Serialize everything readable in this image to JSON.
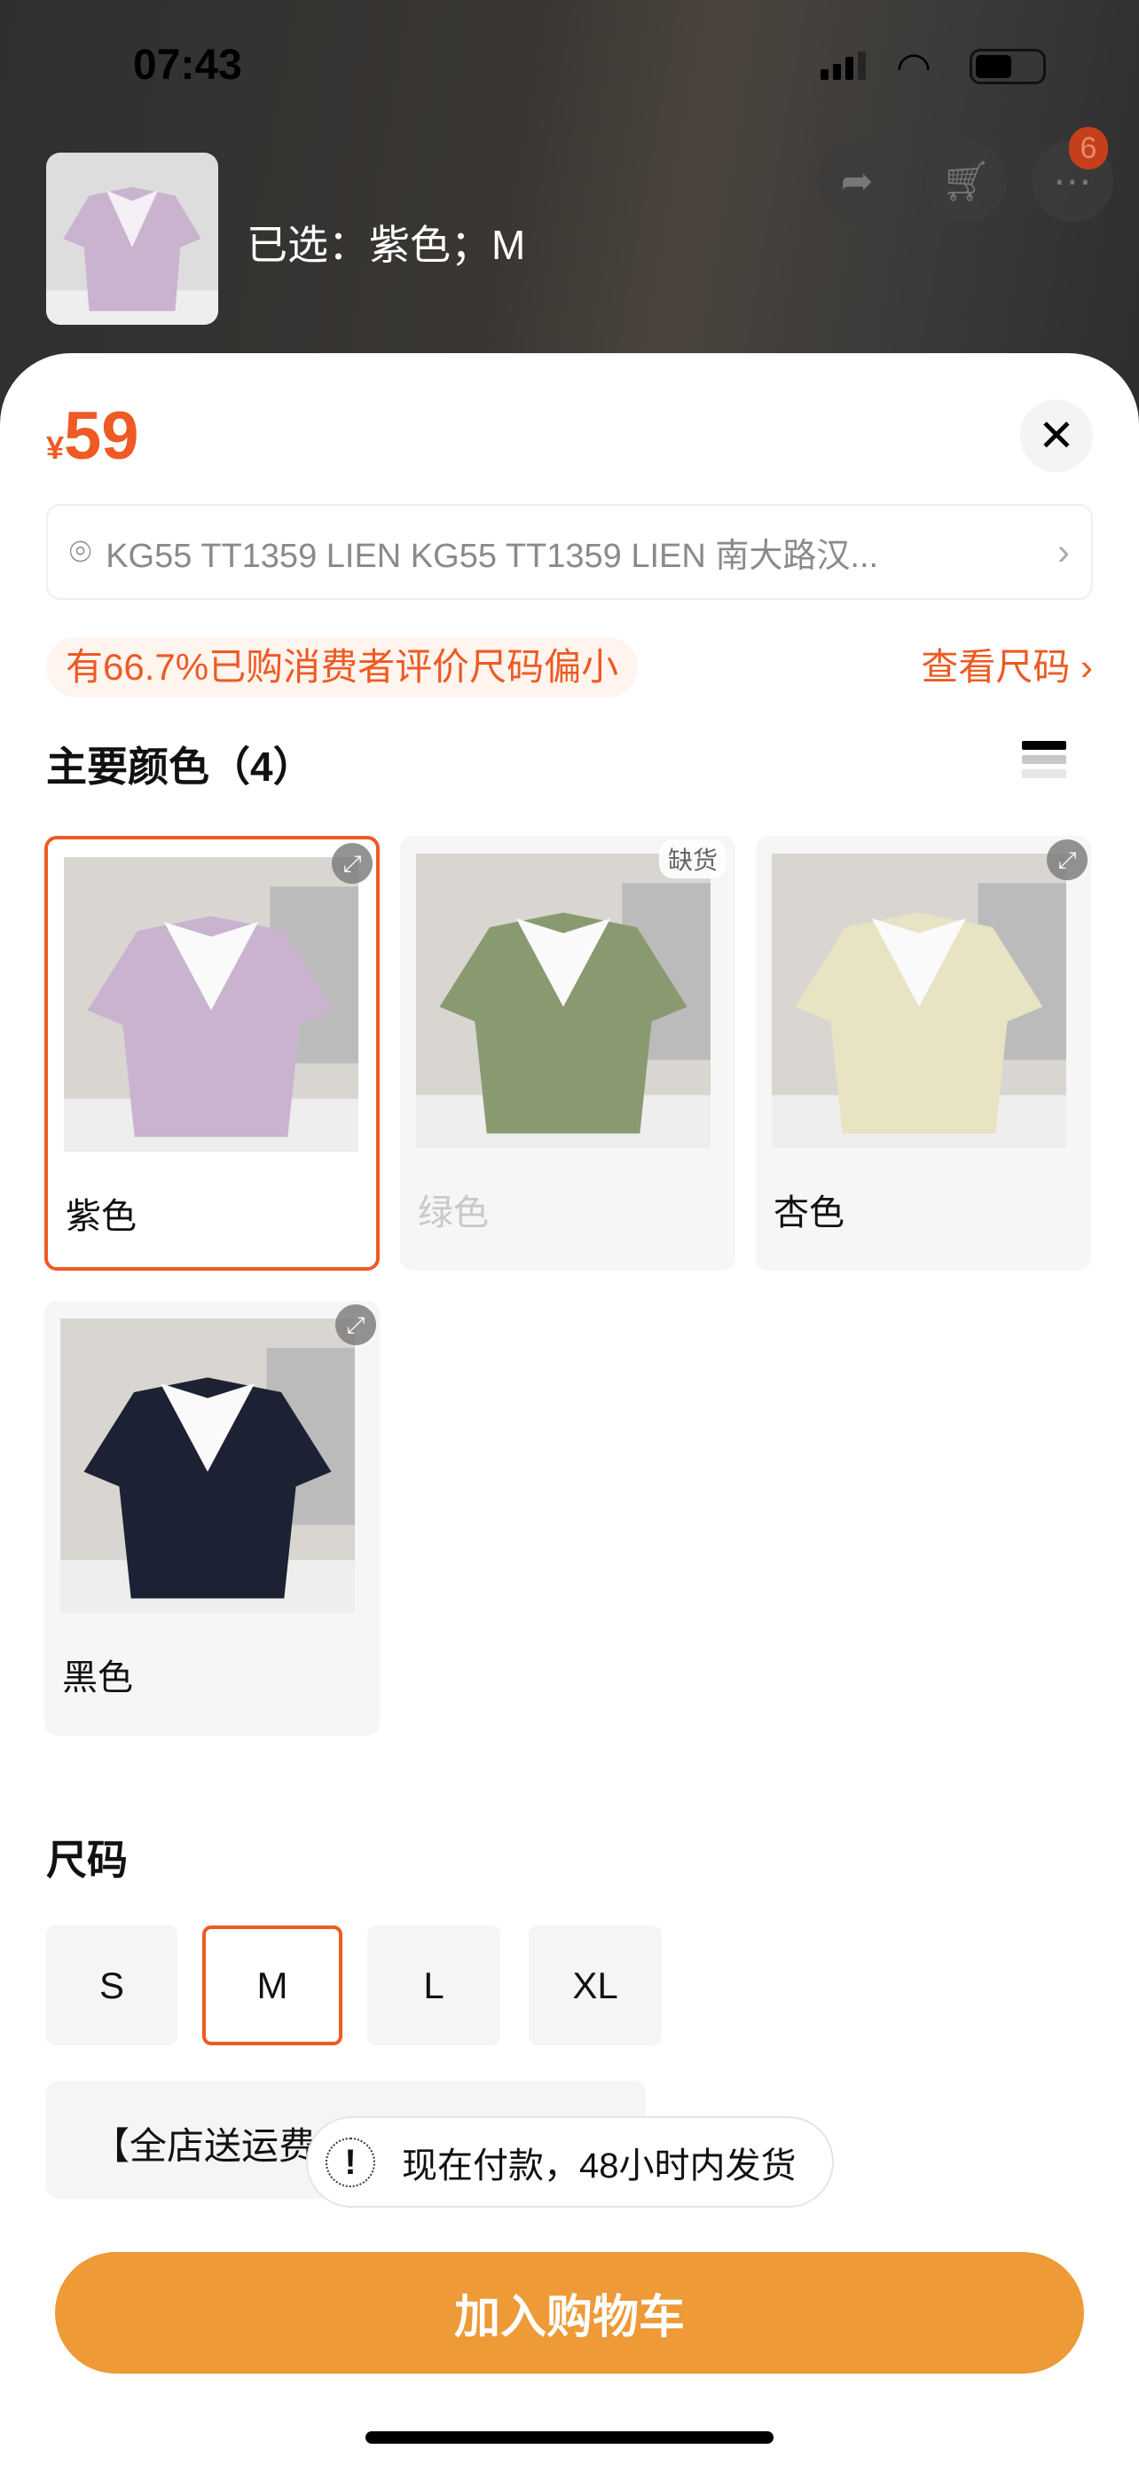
{
  "status_bar": {
    "time": "07:43"
  },
  "header": {
    "selected_text": "已选：紫色；M",
    "cart_badge": "6"
  },
  "price": {
    "currency": "¥",
    "value": "59"
  },
  "address": {
    "text": "KG55 TT1359 LIEN KG55 TT1359 LIEN 南大路汉..."
  },
  "size_hint": {
    "text": "有66.7%已购消费者评价尺码偏小",
    "link": "查看尺码"
  },
  "colors": {
    "title": "主要颜色（4）",
    "items": [
      {
        "label": "紫色",
        "selected": true,
        "out_of_stock": false,
        "color": "#c9b3cf"
      },
      {
        "label": "绿色",
        "selected": false,
        "out_of_stock": true,
        "oos_label": "缺货",
        "color": "#8a9a70"
      },
      {
        "label": "杏色",
        "selected": false,
        "out_of_stock": false,
        "color": "#e7e3c3"
      },
      {
        "label": "黑色",
        "selected": false,
        "out_of_stock": false,
        "color": "#1c2233"
      }
    ]
  },
  "sizes": {
    "title": "尺码",
    "items": [
      "S",
      "M",
      "L",
      "XL"
    ],
    "selected": "M"
  },
  "promo": {
    "text": "【全店送运费"
  },
  "toast": {
    "text": "现在付款，48小时内发货"
  },
  "cta": {
    "label": "加入购物车"
  },
  "accent": "#ee5a24",
  "button_color": "#ed9a37"
}
